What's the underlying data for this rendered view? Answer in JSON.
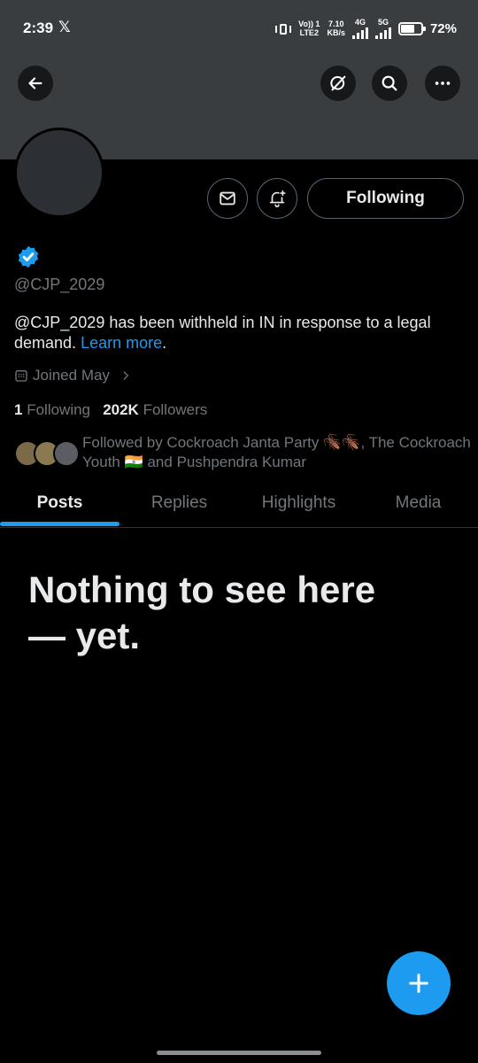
{
  "status_bar": {
    "time": "2:39",
    "x_logo": "𝕏",
    "volte": "Vo)) 1",
    "lte": "LTE2",
    "speed": "7.10",
    "speed_unit": "KB/s",
    "net_4g": "4G",
    "net_5g": "5G",
    "battery": "72%"
  },
  "header": {
    "back_icon": "arrow-left-icon",
    "grok_icon": "grok-icon",
    "search_icon": "search-icon",
    "more_icon": "more-icon"
  },
  "profile": {
    "handle": "@CJP_2029",
    "bio_text": "@CJP_2029 has been withheld in IN in response to a legal demand. ",
    "bio_link": "Learn more",
    "bio_end": ".",
    "joined": "Joined May",
    "following_count": "1",
    "following_label": "Following",
    "followers_count": "202K",
    "followers_label": "Followers",
    "followed_by": "Followed by Cockroach Janta Party 🪳🪳, The Cockroach Youth 🇮🇳 and Pushpendra Kumar"
  },
  "actions": {
    "message_icon": "mail-icon",
    "notify_icon": "bell-plus-icon",
    "following_button": "Following"
  },
  "tabs": [
    {
      "label": "Posts",
      "active": true
    },
    {
      "label": "Replies",
      "active": false
    },
    {
      "label": "Highlights",
      "active": false
    },
    {
      "label": "Media",
      "active": false
    }
  ],
  "empty_state": {
    "title": "Nothing to see here — yet."
  },
  "fab": {
    "icon": "plus-icon"
  },
  "colors": {
    "accent": "#1d9bf0",
    "banner": "#3a3d40",
    "muted": "#71767b"
  }
}
